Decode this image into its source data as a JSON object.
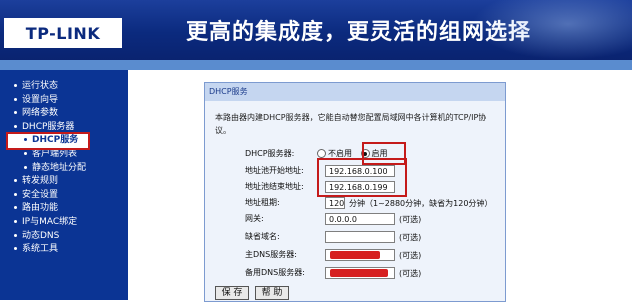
{
  "header": {
    "logo": "TP-LINK",
    "slogan": "更高的集成度，更灵活的组网选择"
  },
  "sidebar": {
    "items": [
      {
        "label": "运行状态"
      },
      {
        "label": "设置向导"
      },
      {
        "label": "网络参数"
      },
      {
        "label": "DHCP服务器"
      },
      {
        "label": "DHCP服务"
      },
      {
        "label": "客户端列表"
      },
      {
        "label": "静态地址分配"
      },
      {
        "label": "转发规则"
      },
      {
        "label": "安全设置"
      },
      {
        "label": "路由功能"
      },
      {
        "label": "IP与MAC绑定"
      },
      {
        "label": "动态DNS"
      },
      {
        "label": "系统工具"
      }
    ]
  },
  "panel": {
    "title": "DHCP服务",
    "description": "本路由器内建DHCP服务器，它能自动替您配置局域网中各计算机的TCP/IP协议。",
    "dhcp_server": {
      "label": "DHCP服务器:",
      "option_off": "不启用",
      "option_on": "启用"
    },
    "start_ip": {
      "label": "地址池开始地址:",
      "value": "192.168.0.100"
    },
    "end_ip": {
      "label": "地址池结束地址:",
      "value": "192.168.0.199"
    },
    "lease": {
      "label": "地址租期:",
      "value": "120",
      "hint": "分钟（1~2880分钟，缺省为120分钟）"
    },
    "gateway": {
      "label": "网关:",
      "value": "0.0.0.0",
      "hint": "(可选)"
    },
    "domain": {
      "label": "缺省域名:",
      "value": "",
      "hint": "(可选)"
    },
    "dns1": {
      "label": "主DNS服务器:",
      "hint": "(可选)"
    },
    "dns2": {
      "label": "备用DNS服务器:",
      "hint": "(可选)"
    },
    "save_label": "保 存",
    "help_label": "帮 助"
  },
  "colors": {
    "header_blue": "#0b2a7e",
    "sidebar_blue": "#0b3494",
    "highlight_red": "#c41a1a"
  }
}
